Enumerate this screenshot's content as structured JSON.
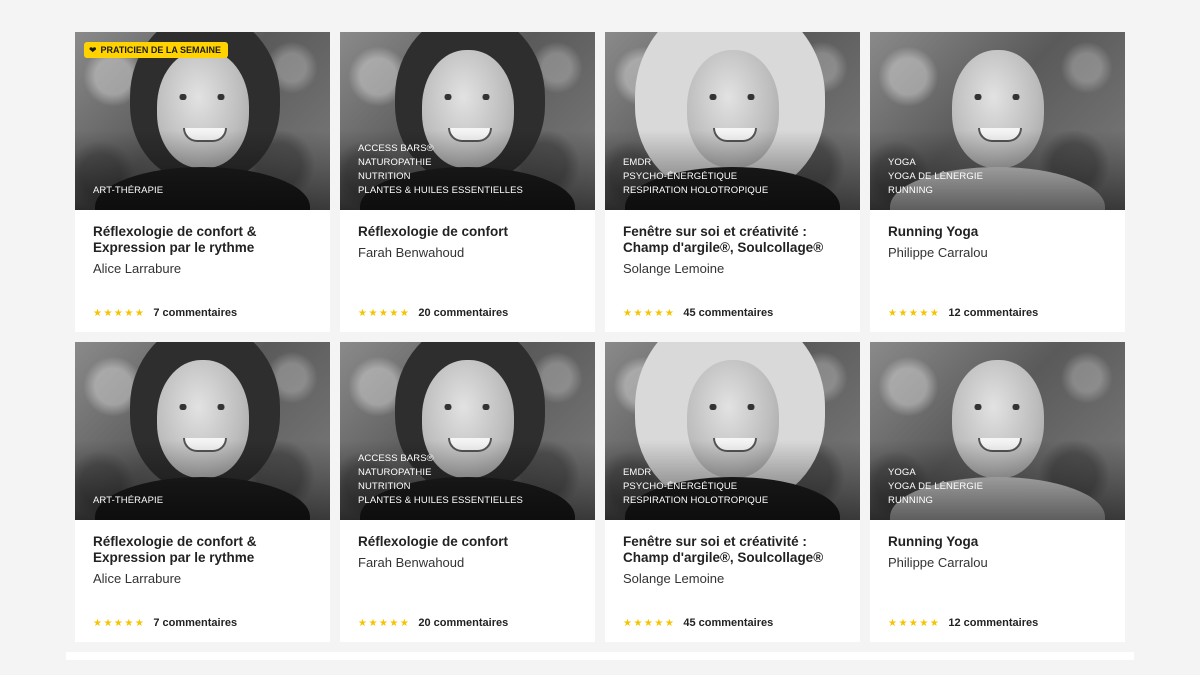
{
  "badge": {
    "label": "PRATICIEN DE LA SEMAINE",
    "icon": "heart-icon"
  },
  "colors": {
    "accent": "#ffd200",
    "stars": "#f5c400",
    "background": "#f4f4f4"
  },
  "cards": [
    {
      "tags": [
        "ART-THÉRAPIE"
      ],
      "title": "Réflexologie de confort & Expression par le rythme",
      "author": "Alice Larrabure",
      "stars": "★★★★★",
      "comments": "7 commentaires"
    },
    {
      "tags": [
        "ACCESS BARS®",
        "NATUROPATHIE",
        "NUTRITION",
        "PLANTES & HUILES ESSENTIELLES"
      ],
      "title": "Réflexologie de confort",
      "author": "Farah Benwahoud",
      "stars": "★★★★★",
      "comments": "20 commentaires"
    },
    {
      "tags": [
        "EMDR",
        "PSYCHO-ÉNERGÉTIQUE",
        "RESPIRATION HOLOTROPIQUE"
      ],
      "title": "Fenêtre sur soi et créativité : Champ d'argile®, Soulcollage®",
      "author": "Solange Lemoine",
      "stars": "★★★★★",
      "comments": "45 commentaires"
    },
    {
      "tags": [
        "YOGA",
        "YOGA DE LÉNERGIE",
        "RUNNING"
      ],
      "title": "Running Yoga",
      "author": "Philippe Carralou",
      "stars": "★★★★★",
      "comments": "12 commentaires"
    }
  ]
}
